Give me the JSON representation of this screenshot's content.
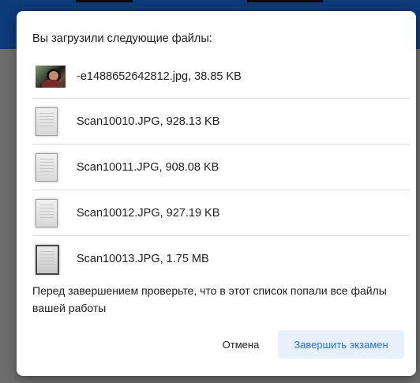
{
  "dialog": {
    "heading": "Вы загрузили следующие файлы:",
    "files": [
      {
        "name": "-e1488652642812.jpg, 38.85 KB",
        "thumbnail": "photo"
      },
      {
        "name": "Scan10010.JPG, 928.13 KB",
        "thumbnail": "document"
      },
      {
        "name": "Scan10011.JPG, 908.08 KB",
        "thumbnail": "document"
      },
      {
        "name": "Scan10012.JPG, 927.19 KB",
        "thumbnail": "document"
      },
      {
        "name": "Scan10013.JPG, 1.75 MB",
        "thumbnail": "document"
      }
    ],
    "note": "Перед завершением проверьте, что в этот список попали все файлы вашей работы",
    "cancel_label": "Отмена",
    "finish_label": "Завершить экзамен"
  },
  "colors": {
    "backdrop_header": "#0d3a78",
    "primary_button_bg": "#e8f0fe",
    "primary_button_text": "#1a73e8",
    "divider": "#dadce0"
  }
}
